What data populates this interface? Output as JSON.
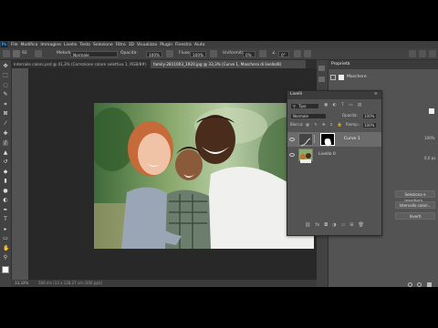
{
  "app": {
    "logo": "Ps",
    "menu": [
      "File",
      "Modifica",
      "Immagine",
      "Livello",
      "Testo",
      "Selezione",
      "Filtro",
      "3D",
      "Visualizza",
      "Plugin",
      "Finestra",
      "Aiuto"
    ]
  },
  "options_bar": {
    "brush_size": "92",
    "mode_label": "Metodo:",
    "mode_value": "Normale",
    "opacity_label": "Opacità:",
    "opacity_value": "100%",
    "flow_label": "Flusso:",
    "flow_value": "100%",
    "smoothing_label": "Uniformità:",
    "smoothing_value": "0%",
    "angle_value": "0°"
  },
  "tabs": [
    {
      "label": "Interrailo coloni.psd @ 41,3% (Correzione colore selettiva 1, RGB/8#)",
      "active": false
    },
    {
      "label": "family-2811003_1920.jpg @ 33,3% (Curve 1, Maschera di livello/8)",
      "active": true
    }
  ],
  "status": {
    "zoom": "33,33%",
    "doc": "566 ms (13 x 128,27 cm (300 ppi))"
  },
  "properties": {
    "title": "Proprietà",
    "subtitle": "Maschere",
    "value1": "100%",
    "value2": "0,0 px"
  },
  "layers": {
    "title": "Livelli",
    "filter_label": "Tipo",
    "blend_mode": "Normale",
    "opacity_label": "Opacità:",
    "opacity_value": "100%",
    "lock_label": "Blocca:",
    "fill_label": "Riemp.:",
    "fill_value": "100%",
    "items": [
      {
        "name": "Curve 1",
        "selected": true
      },
      {
        "name": "Livello 0",
        "selected": false
      }
    ]
  },
  "mask_buttons": {
    "select_mask": "Seleziona e maschera...",
    "color_range": "Intervallo colori...",
    "invert": "Inverti"
  },
  "colors": {
    "accent": "#31a8ff",
    "bg": "#535353",
    "panel_dark": "#424242",
    "canvas": "#282828"
  }
}
